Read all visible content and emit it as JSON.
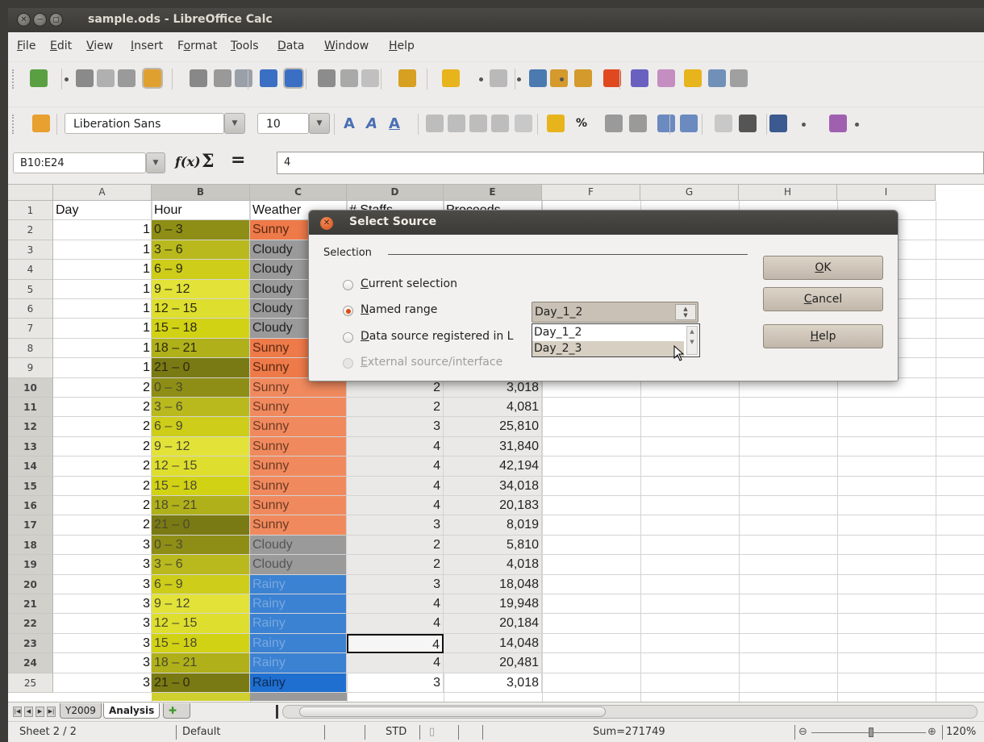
{
  "window": {
    "title": "sample.ods - LibreOffice Calc",
    "controls": [
      "close",
      "minimize",
      "maximize"
    ]
  },
  "menu": [
    {
      "pre": "",
      "key": "F",
      "post": "ile"
    },
    {
      "pre": "",
      "key": "E",
      "post": "dit"
    },
    {
      "pre": "",
      "key": "V",
      "post": "iew"
    },
    {
      "pre": "",
      "key": "I",
      "post": "nsert"
    },
    {
      "pre": "F",
      "key": "o",
      "post": "rmat"
    },
    {
      "pre": "",
      "key": "T",
      "post": "ools"
    },
    {
      "pre": "",
      "key": "D",
      "post": "ata"
    },
    {
      "pre": "",
      "key": "W",
      "post": "indow"
    },
    {
      "pre": "",
      "key": "H",
      "post": "elp"
    }
  ],
  "toolbar_standard_icons": [
    "new-document-icon",
    "open-icon",
    "save-icon",
    "email-icon",
    "edit-file-icon",
    "export-pdf-icon",
    "print-icon",
    "print-preview-icon",
    "spellcheck-icon",
    "autospellcheck-icon",
    "cut-icon",
    "copy-icon",
    "paste-icon",
    "clone-format-icon",
    "undo-icon",
    "redo-icon",
    "navigator-icon",
    "sort-ascending-icon",
    "sort-descending-icon",
    "insert-chart-icon",
    "show-draw-functions-icon",
    "gallery-icon",
    "stars-icon",
    "data-sources-icon",
    "styles-icon"
  ],
  "formatting": {
    "font_name": "Liberation Sans",
    "font_size": "10",
    "icons": [
      "bold-icon",
      "italic-icon",
      "underline-icon",
      "align-left-icon",
      "align-center-icon",
      "align-right-icon",
      "justify-icon",
      "merge-cells-icon",
      "currency-icon",
      "percent-icon",
      "standard-format-icon",
      "add-decimal-icon",
      "delete-decimal-icon",
      "decrease-indent-icon",
      "increase-indent-icon",
      "borders-icon",
      "background-color-icon",
      "font-color-icon"
    ],
    "percent_label": "%"
  },
  "formula_bar": {
    "name_box": "B10:E24",
    "fx_label": "f(x)",
    "sum_label": "Σ",
    "equals_label": "=",
    "content": "4"
  },
  "grid": {
    "columns": [
      "A",
      "B",
      "C",
      "D",
      "E",
      "F",
      "G",
      "H",
      "I"
    ],
    "selected_columns": [
      "B",
      "C",
      "D",
      "E"
    ],
    "header_row": [
      "Day",
      "Hour",
      "Weather",
      "# Staffs",
      "Proceeds"
    ],
    "rows": [
      {
        "n": "1"
      },
      {
        "n": "2",
        "a": "1",
        "b": "0 – 3",
        "c": "Sunny"
      },
      {
        "n": "3",
        "a": "1",
        "b": "3 – 6",
        "c": "Cloudy"
      },
      {
        "n": "4",
        "a": "1",
        "b": "6 – 9",
        "c": "Cloudy"
      },
      {
        "n": "5",
        "a": "1",
        "b": "9 – 12",
        "c": "Cloudy"
      },
      {
        "n": "6",
        "a": "1",
        "b": "12 – 15",
        "c": "Cloudy"
      },
      {
        "n": "7",
        "a": "1",
        "b": "15 – 18",
        "c": "Cloudy"
      },
      {
        "n": "8",
        "a": "1",
        "b": "18 – 21",
        "c": "Sunny"
      },
      {
        "n": "9",
        "a": "1",
        "b": "21 – 0",
        "c": "Sunny"
      },
      {
        "n": "10",
        "a": "2",
        "b": "0 – 3",
        "c": "Sunny",
        "d": "2",
        "e": "3,018"
      },
      {
        "n": "11",
        "a": "2",
        "b": "3 – 6",
        "c": "Sunny",
        "d": "2",
        "e": "4,081"
      },
      {
        "n": "12",
        "a": "2",
        "b": "6 – 9",
        "c": "Sunny",
        "d": "3",
        "e": "25,810"
      },
      {
        "n": "13",
        "a": "2",
        "b": "9 – 12",
        "c": "Sunny",
        "d": "4",
        "e": "31,840"
      },
      {
        "n": "14",
        "a": "2",
        "b": "12 – 15",
        "c": "Sunny",
        "d": "4",
        "e": "42,194"
      },
      {
        "n": "15",
        "a": "2",
        "b": "15 – 18",
        "c": "Sunny",
        "d": "4",
        "e": "34,018"
      },
      {
        "n": "16",
        "a": "2",
        "b": "18 – 21",
        "c": "Sunny",
        "d": "4",
        "e": "20,183"
      },
      {
        "n": "17",
        "a": "2",
        "b": "21 – 0",
        "c": "Sunny",
        "d": "3",
        "e": "8,019"
      },
      {
        "n": "18",
        "a": "3",
        "b": "0 – 3",
        "c": "Cloudy",
        "d": "2",
        "e": "5,810"
      },
      {
        "n": "19",
        "a": "3",
        "b": "3 – 6",
        "c": "Cloudy",
        "d": "2",
        "e": "4,018"
      },
      {
        "n": "20",
        "a": "3",
        "b": "6 – 9",
        "c": "Rainy",
        "d": "3",
        "e": "18,048"
      },
      {
        "n": "21",
        "a": "3",
        "b": "9 – 12",
        "c": "Rainy",
        "d": "4",
        "e": "19,948"
      },
      {
        "n": "22",
        "a": "3",
        "b": "12 – 15",
        "c": "Rainy",
        "d": "4",
        "e": "20,184"
      },
      {
        "n": "23",
        "a": "3",
        "b": "15 – 18",
        "c": "Rainy",
        "d": "4",
        "e": "14,048"
      },
      {
        "n": "24",
        "a": "3",
        "b": "18 – 21",
        "c": "Rainy",
        "d": "4",
        "e": "20,481"
      },
      {
        "n": "25",
        "a": "3",
        "b": "21 – 0",
        "c": "Rainy",
        "d": "3",
        "e": "3,018"
      }
    ],
    "colors": {
      "sunny": "#ee7a4a",
      "sunny_selected": "#f08a5e",
      "cloudy": "#9a9a9a",
      "rainy": "#2f7dd1",
      "rainy_selected": "#3b82d3",
      "rainy_last": "#1f6fd0",
      "hour_shades": [
        "#8e8e16",
        "#b9b91e",
        "#cdcd1a",
        "#e2e239",
        "#dede2e",
        "#d2d215",
        "#b0b01a",
        "#7a7a14"
      ]
    }
  },
  "sheet_tabs": {
    "tabs": [
      "Y2009",
      "Analysis"
    ],
    "active": "Analysis"
  },
  "status_bar": {
    "sheet": "Sheet 2 / 2",
    "style": "Default",
    "mode": "STD",
    "sum": "Sum=271749",
    "zoom": "120%"
  },
  "dialog": {
    "title": "Select Source",
    "group_label": "Selection",
    "options": [
      {
        "label": "Current selection",
        "underline": "C",
        "rest": "urrent selection",
        "selected": false,
        "enabled": true
      },
      {
        "label": "Named range",
        "underline": "N",
        "rest": "amed range",
        "selected": true,
        "enabled": true
      },
      {
        "label": "Data source registered in LibreOffice",
        "underline": "D",
        "rest": "ata source registered in ",
        "cut": "L",
        "selected": false,
        "enabled": true
      },
      {
        "label": "External source/interface",
        "underline": "E",
        "rest": "xternal source/interface",
        "selected": false,
        "enabled": false
      }
    ],
    "named_range_value": "Day_1_2",
    "named_range_options": [
      "Day_1_2",
      "Day_2_3"
    ],
    "highlighted_option": "Day_2_3",
    "buttons": [
      {
        "u": "O",
        "rest": "K"
      },
      {
        "u": "C",
        "rest": "ancel"
      },
      {
        "u": "H",
        "rest": "elp"
      }
    ]
  }
}
